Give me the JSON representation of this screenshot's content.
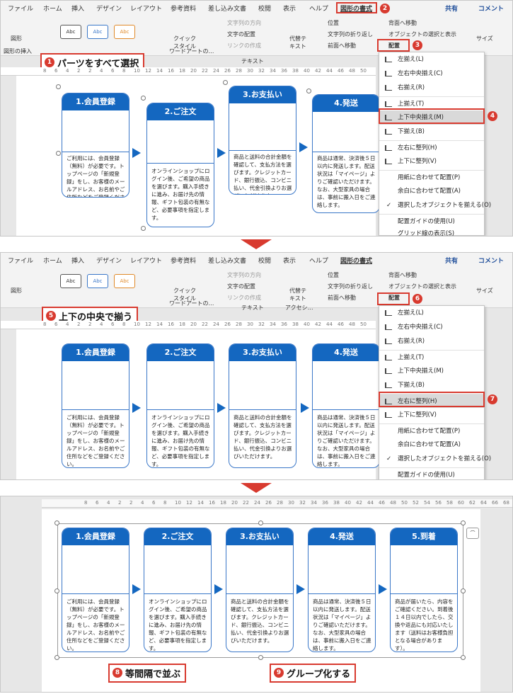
{
  "menu": {
    "tabs": [
      "ファイル",
      "ホーム",
      "挿入",
      "デザイン",
      "レイアウト",
      "参考資料",
      "差し込み文書",
      "校閲",
      "表示",
      "ヘルプ",
      "図形の書式"
    ],
    "share": "共有",
    "comment": "コメント"
  },
  "ribbon": {
    "shape_label": "図形",
    "insert_group": "図形の挿入",
    "style_btn": "Abc",
    "quick_style": "クイック\nスタイル",
    "wordart_group": "ワードアートの…",
    "text_direction": "文字列の方向",
    "text_align": "文字の配置",
    "link_create": "リンクの作成",
    "text_group": "テキスト",
    "alt_text": "代替テ\nキスト",
    "access_group": "アクセシ…",
    "position": "位置",
    "wrap": "文字列の折り返し",
    "bring_front": "前面へ移動",
    "send_back": "背面へ移動",
    "select_pane": "オブジェクトの選択と表示",
    "arrange": "配置",
    "size": "サイズ"
  },
  "callouts": {
    "c1": "パーツをすべて選択",
    "c5": "上下の中央で揃う",
    "c8": "等間隔で並ぶ",
    "c9": "グループ化する"
  },
  "steps": {
    "s1": "1",
    "s2": "2",
    "s3": "3",
    "s4": "4",
    "s5": "5",
    "s6": "6",
    "s7": "7",
    "s8": "8",
    "s9": "9"
  },
  "ruler_nums": [
    "8",
    "6",
    "4",
    "2",
    "2",
    "4",
    "6",
    "8",
    "10",
    "12",
    "14",
    "16",
    "18",
    "20",
    "22",
    "24",
    "26",
    "28",
    "30",
    "32",
    "34",
    "36",
    "38",
    "40",
    "42",
    "44",
    "46",
    "48",
    "50",
    "52",
    "54",
    "56",
    "58",
    "60",
    "62",
    "64",
    "66",
    "68"
  ],
  "cards": [
    {
      "title": "1.会員登録",
      "body": "ご利用には、会員登録（無料）が必要です。トップページの「新規登録」をし、お客様のメールアドレス、お名前やご住所などをご登録ください。"
    },
    {
      "title": "2.ご注文",
      "body": "オンラインショップにログイン後、ご希望の商品を選びます。購入手続きに進み、お届け先の情報、ギフト包装の有無など、必要事項を指定します。"
    },
    {
      "title": "3.お支払い",
      "body": "商品と送料の合計金額を確認して、支払方法を選びます。クレジットカード、銀行振込、コンビニ払い、代金引換よりお選びいただけます。"
    },
    {
      "title": "4.発送",
      "body": "商品は通常、決済後５日以内に発送します。配送状況は「マイページ」よりご確認いただけます。なお、大型家具の場合は、事前に搬入日をご連絡します。"
    },
    {
      "title": "5.到着",
      "body": "商品が届いたら、内容をご確認ください。到着後１４日以内でしたら、交換や返品にも対応いたします（送料はお客様負担となる場合があります）。"
    }
  ],
  "menu_items": [
    {
      "label": "左揃え(L)"
    },
    {
      "label": "左右中央揃え(C)"
    },
    {
      "label": "右揃え(R)"
    },
    {
      "label": "上揃え(T)"
    },
    {
      "label": "上下中央揃え(M)"
    },
    {
      "label": "下揃え(B)"
    },
    {
      "label": "左右に整列(H)"
    },
    {
      "label": "上下に整列(V)"
    },
    {
      "label": "用紙に合わせて配置(P)"
    },
    {
      "label": "余白に合わせて配置(A)"
    },
    {
      "label": "選択したオブジェクトを揃える(O)"
    },
    {
      "label": "配置ガイドの使用(U)"
    },
    {
      "label": "グリッド線の表示(S)"
    }
  ],
  "colors": {
    "accent": "#1467c0",
    "callout": "#d83a2f"
  }
}
